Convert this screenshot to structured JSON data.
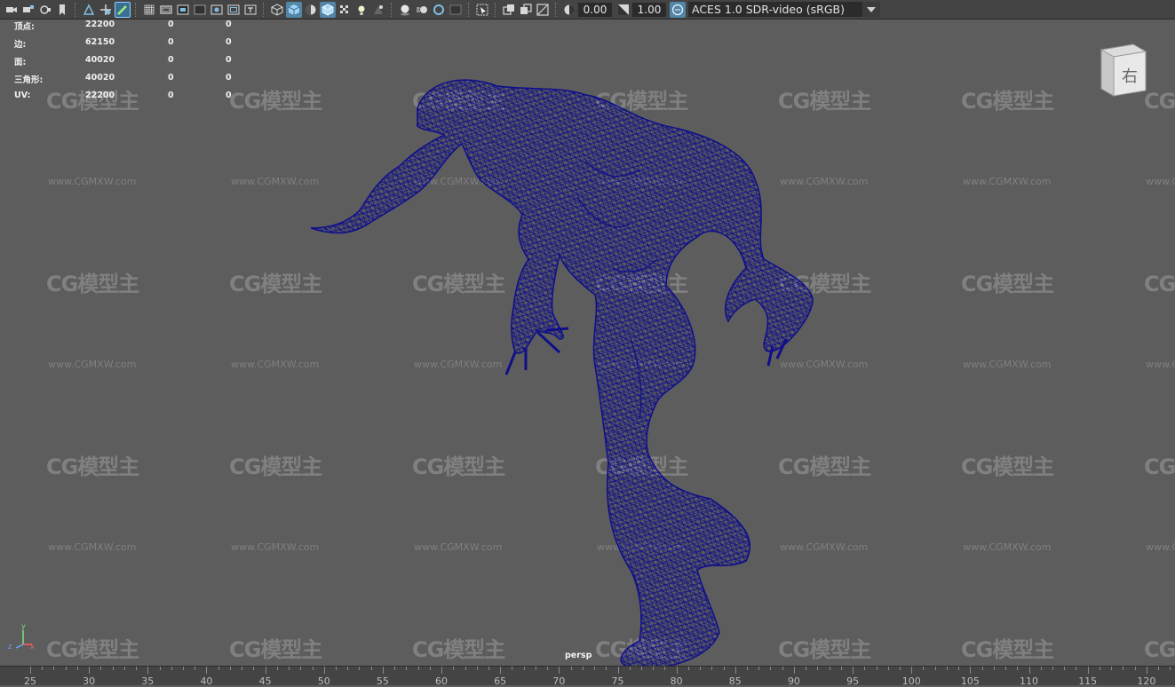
{
  "toolbar": {
    "exposure_value": "0.00",
    "gamma_value": "1.00",
    "view_transform": "ACES 1.0 SDR-video (sRGB)",
    "accent_color": "#5285a6"
  },
  "hud": {
    "rows": [
      {
        "label": "顶点:",
        "v1": "22200",
        "v2": "0",
        "v3": "0"
      },
      {
        "label": "边:",
        "v1": "62150",
        "v2": "0",
        "v3": "0"
      },
      {
        "label": "面:",
        "v1": "40020",
        "v2": "0",
        "v3": "0"
      },
      {
        "label": "三角形:",
        "v1": "40020",
        "v2": "0",
        "v3": "0"
      },
      {
        "label": "UV:",
        "v1": "22200",
        "v2": "0",
        "v3": "0"
      }
    ]
  },
  "viewport": {
    "camera": "persp",
    "view_cube_face": "右",
    "axis_labels": {
      "y": "y",
      "z": "z",
      "x": "x"
    },
    "wireframe_color": "#0f0f8a"
  },
  "watermark": {
    "logo": "CG模型主",
    "url": "www.CGMXW.com"
  },
  "timeline": {
    "ticks": [
      "25",
      "30",
      "35",
      "40",
      "45",
      "50",
      "55",
      "60",
      "65",
      "70",
      "75",
      "80",
      "85",
      "90",
      "95",
      "100",
      "105",
      "110",
      "115",
      "120"
    ]
  }
}
